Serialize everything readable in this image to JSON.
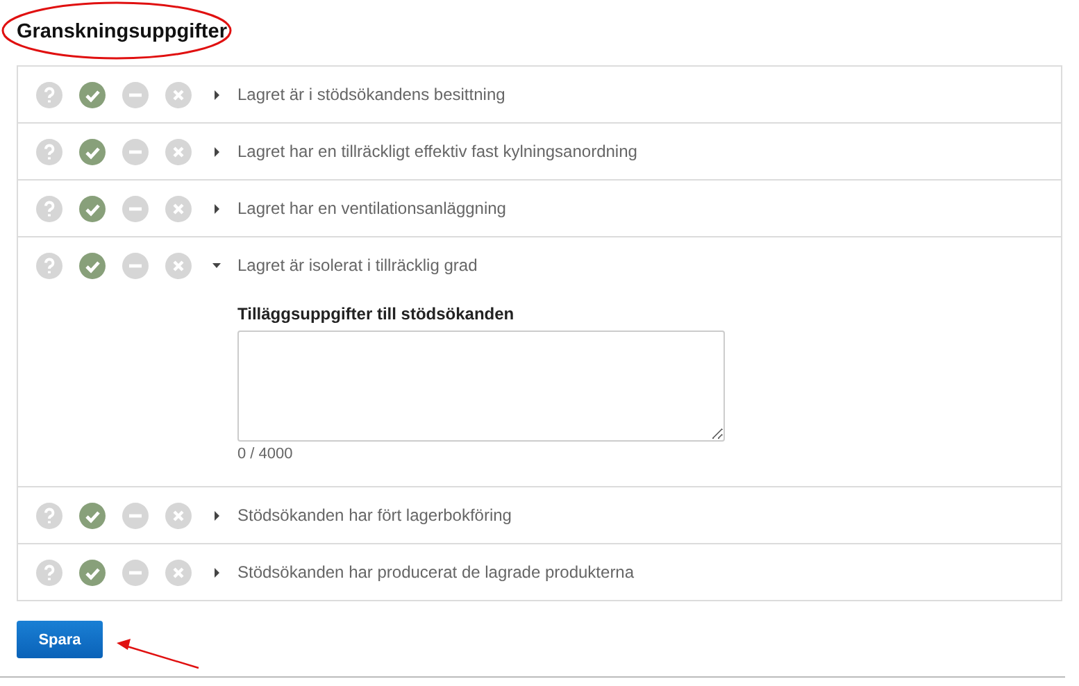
{
  "title": "Granskningsuppgifter",
  "rows": [
    {
      "label": "Lagret är i stödsökandens besittning",
      "expanded": false,
      "statuses": [
        {
          "kind": "unknown",
          "selected": false
        },
        {
          "kind": "approved",
          "selected": true
        },
        {
          "kind": "partial",
          "selected": false
        },
        {
          "kind": "rejected",
          "selected": false
        }
      ]
    },
    {
      "label": "Lagret har en tillräckligt effektiv fast kylningsanordning",
      "expanded": false,
      "statuses": [
        {
          "kind": "unknown",
          "selected": false
        },
        {
          "kind": "approved",
          "selected": true
        },
        {
          "kind": "partial",
          "selected": false
        },
        {
          "kind": "rejected",
          "selected": false
        }
      ]
    },
    {
      "label": "Lagret har en ventilationsanläggning",
      "expanded": false,
      "statuses": [
        {
          "kind": "unknown",
          "selected": false
        },
        {
          "kind": "approved",
          "selected": true
        },
        {
          "kind": "partial",
          "selected": false
        },
        {
          "kind": "rejected",
          "selected": false
        }
      ]
    },
    {
      "label": "Lagret är isolerat i tillräcklig grad",
      "expanded": true,
      "statuses": [
        {
          "kind": "unknown",
          "selected": false
        },
        {
          "kind": "approved",
          "selected": true
        },
        {
          "kind": "partial",
          "selected": false
        },
        {
          "kind": "rejected",
          "selected": false
        }
      ],
      "detail": {
        "label": "Tilläggsuppgifter till stödsökanden",
        "counter": "0 / 4000"
      }
    },
    {
      "label": "Stödsökanden har fört lagerbokföring",
      "expanded": false,
      "statuses": [
        {
          "kind": "unknown",
          "selected": false
        },
        {
          "kind": "approved",
          "selected": true
        },
        {
          "kind": "partial",
          "selected": false
        },
        {
          "kind": "rejected",
          "selected": false
        }
      ]
    },
    {
      "label": "Stödsökanden har producerat de lagrade produkterna",
      "expanded": false,
      "statuses": [
        {
          "kind": "unknown",
          "selected": false
        },
        {
          "kind": "approved",
          "selected": true
        },
        {
          "kind": "partial",
          "selected": false
        },
        {
          "kind": "rejected",
          "selected": false
        }
      ]
    }
  ],
  "save_button": "Spara"
}
